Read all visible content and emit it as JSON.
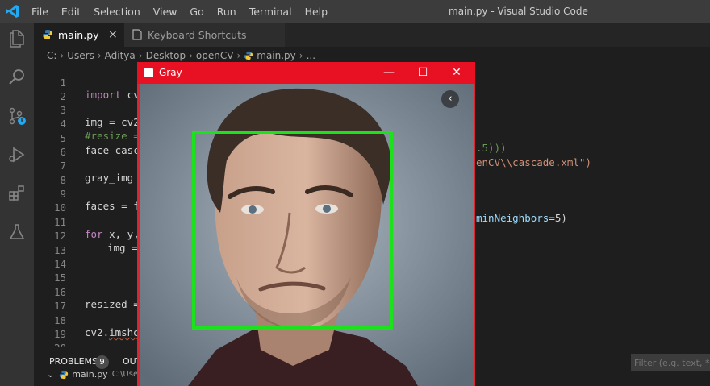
{
  "window": {
    "title": "main.py - Visual Studio Code",
    "menu": [
      "File",
      "Edit",
      "Selection",
      "View",
      "Go",
      "Run",
      "Terminal",
      "Help"
    ]
  },
  "tabs": [
    {
      "label": "main.py",
      "close": "×"
    },
    {
      "label": "Keyboard Shortcuts"
    }
  ],
  "breadcrumb": [
    "C:",
    "Users",
    "Aditya",
    "Desktop",
    "openCV",
    "main.py",
    "..."
  ],
  "editor": {
    "line_numbers": [
      "1",
      "2",
      "3",
      "4",
      "5",
      "6",
      "7",
      "8",
      "9",
      "10",
      "11",
      "12",
      "13",
      "14",
      "15",
      "16",
      "17",
      "18",
      "19",
      "20"
    ],
    "line1_kw": "import",
    "line1_rest": " cv",
    "line3": "img = cv2",
    "line4": "#resize =",
    "line4_right": ".5)))",
    "line5": "face_casc",
    "line5_right": "enCV\\\\cascade.xml\")",
    "line7": "gray_img",
    "line9": "faces = f",
    "line9_right_var": "minNeighbors",
    "line9_right_rest": "=5)",
    "line11_kw": "for",
    "line11_rest": " x, y,",
    "line12": "img =",
    "line16": "resized =",
    "line18_a": "cv2.",
    "line18_b": "imsho"
  },
  "panel": {
    "problems_label": "PROBLEMS",
    "problems_count": "9",
    "output_label": "OUT",
    "filter_placeholder": "Filter (e.g. text, **/*.",
    "problem_file": "main.py",
    "problem_path": "C:\\Users"
  },
  "cv_window": {
    "title": "Gray",
    "min": "—",
    "max": "☐",
    "close": "✕",
    "prev": "‹"
  },
  "colors": {
    "titlebar": "#3c3c3c",
    "activity": "#333333",
    "editor_bg": "#1e1e1e",
    "cv_title_red": "#e81123",
    "face_box_green": "#1ce21c",
    "vscode_blue": "#23a9f2"
  }
}
